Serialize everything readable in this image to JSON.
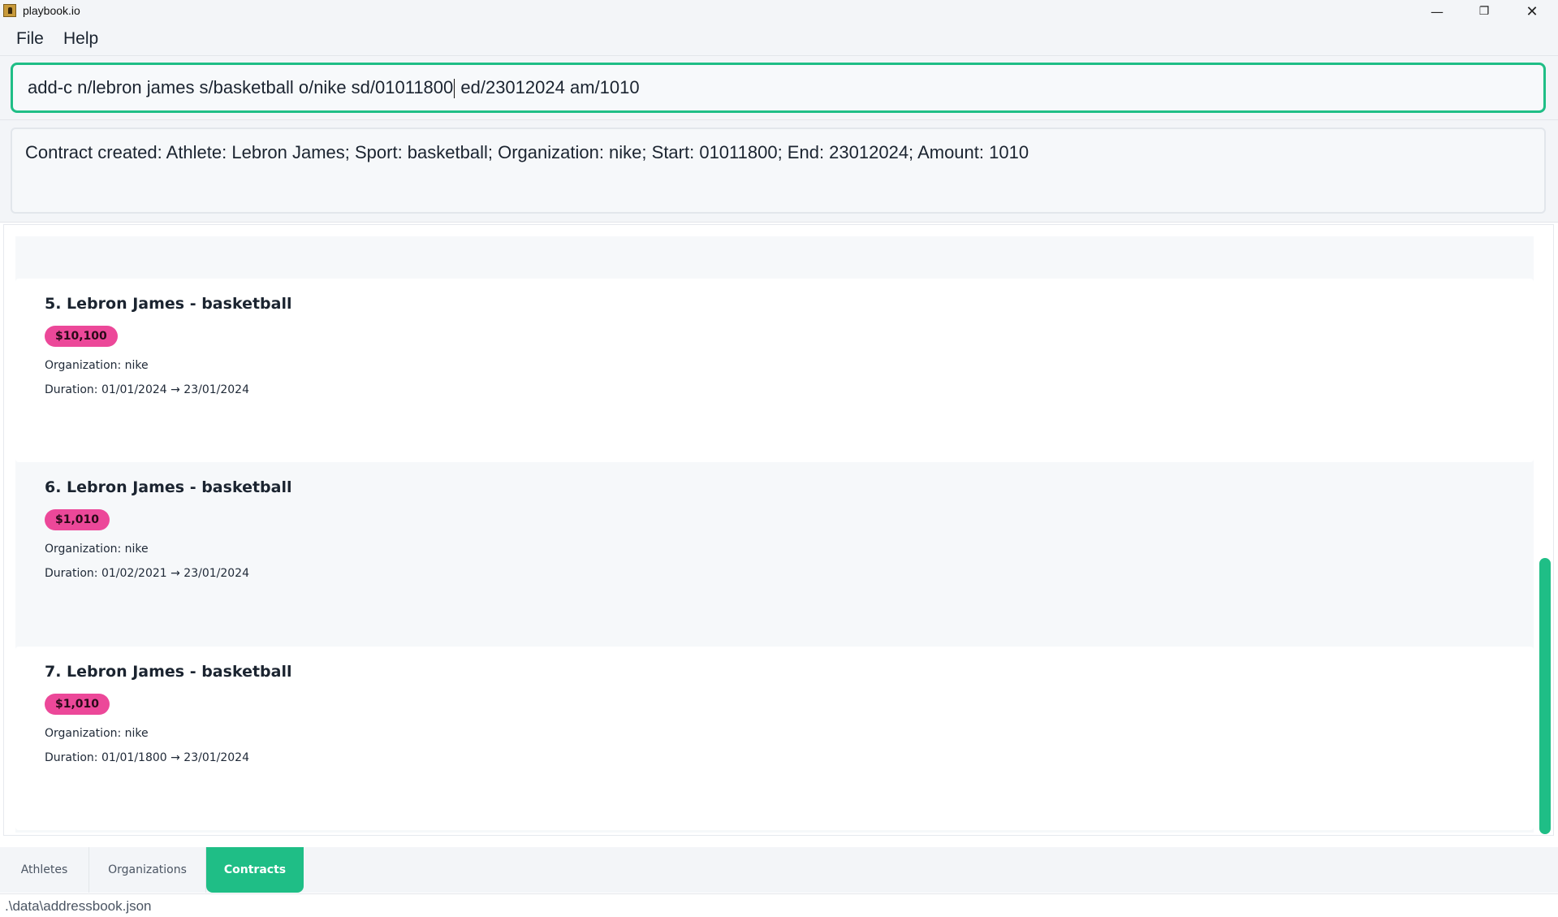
{
  "window": {
    "title": "playbook.io",
    "minimize_glyph": "—",
    "maximize_glyph": "❐",
    "close_glyph": "✕"
  },
  "menu": {
    "file": "File",
    "help": "Help"
  },
  "command": {
    "before_caret": "add-c n/lebron james s/basketball o/nike sd/01011800",
    "after_caret": " ed/23012024 am/1010"
  },
  "result": {
    "text": "Contract created: Athlete: Lebron James; Sport: basketball; Organization: nike; Start: 01011800; End: 23012024; Amount: 1010"
  },
  "contracts": [
    {
      "title": "5. Lebron James - basketball",
      "amount": "$10,100",
      "organization": "Organization: nike",
      "duration": "Duration: 01/01/2024 → 23/01/2024"
    },
    {
      "title": "6. Lebron James - basketball",
      "amount": "$1,010",
      "organization": "Organization: nike",
      "duration": "Duration: 01/02/2021 → 23/01/2024"
    },
    {
      "title": "7. Lebron James - basketball",
      "amount": "$1,010",
      "organization": "Organization: nike",
      "duration": "Duration: 01/01/1800 → 23/01/2024"
    }
  ],
  "tabs": {
    "athletes": "Athletes",
    "organizations": "Organizations",
    "contracts": "Contracts",
    "active": "Contracts"
  },
  "status": {
    "path": ".\\data\\addressbook.json"
  },
  "colors": {
    "accent": "#1fbe86",
    "amount_badge": "#ec4899"
  },
  "icons": {
    "app": "playbook-app-icon"
  }
}
